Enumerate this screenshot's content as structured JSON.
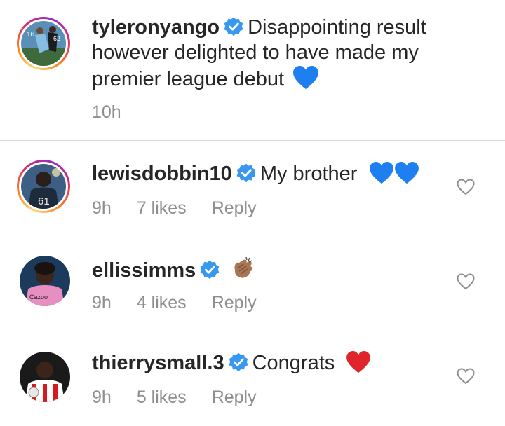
{
  "caption": {
    "username": "tyleronyango",
    "text_line1": "Disappointing result",
    "text_line2": "however delighted to have made my",
    "text_line3": "premier league debut",
    "time": "10h"
  },
  "comments": [
    {
      "username": "lewisdobbin10",
      "text": "My brother",
      "time": "9h",
      "likes": "7 likes",
      "reply": "Reply",
      "emoji": "blue-heart x2"
    },
    {
      "username": "ellissimms",
      "text": "",
      "time": "9h",
      "likes": "4 likes",
      "reply": "Reply",
      "emoji": "clapping-hands"
    },
    {
      "username": "thierrysmall.3",
      "text": "Congrats",
      "time": "9h",
      "likes": "5 likes",
      "reply": "Reply",
      "emoji": "red-heart"
    }
  ],
  "colors": {
    "verified": "#3897f0",
    "meta": "#8e8e8e",
    "blue_heart": "#1e7ff0",
    "red_heart": "#e0242b"
  }
}
